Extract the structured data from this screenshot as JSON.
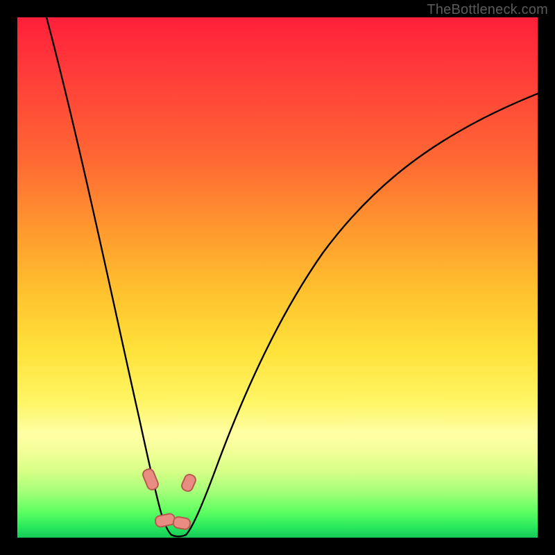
{
  "attribution": "TheBottleneck.com",
  "chart_data": {
    "type": "line",
    "title": "",
    "xlabel": "",
    "ylabel": "",
    "xlim": [
      0,
      100
    ],
    "ylim": [
      0,
      100
    ],
    "background": "vertical gradient red→orange→yellow→green (heat scale)",
    "series": [
      {
        "name": "bottleneck-curve",
        "description": "V-shaped curve; sharp minimum near x≈28 at y≈0, rises steeply both sides",
        "x": [
          5,
          10,
          15,
          20,
          23,
          25,
          27,
          28,
          30,
          32,
          35,
          40,
          50,
          60,
          70,
          80,
          90,
          100
        ],
        "values": [
          100,
          80,
          58,
          33,
          15,
          6,
          1,
          0,
          1,
          5,
          15,
          30,
          52,
          67,
          77,
          84,
          89,
          92
        ]
      }
    ],
    "markers": [
      {
        "name": "marker-left-upper",
        "x": 24.5,
        "y": 10
      },
      {
        "name": "marker-right-upper",
        "x": 31.0,
        "y": 9
      },
      {
        "name": "marker-bottom-left",
        "x": 26.0,
        "y": 1
      },
      {
        "name": "marker-bottom-right",
        "x": 29.5,
        "y": 1
      }
    ]
  }
}
